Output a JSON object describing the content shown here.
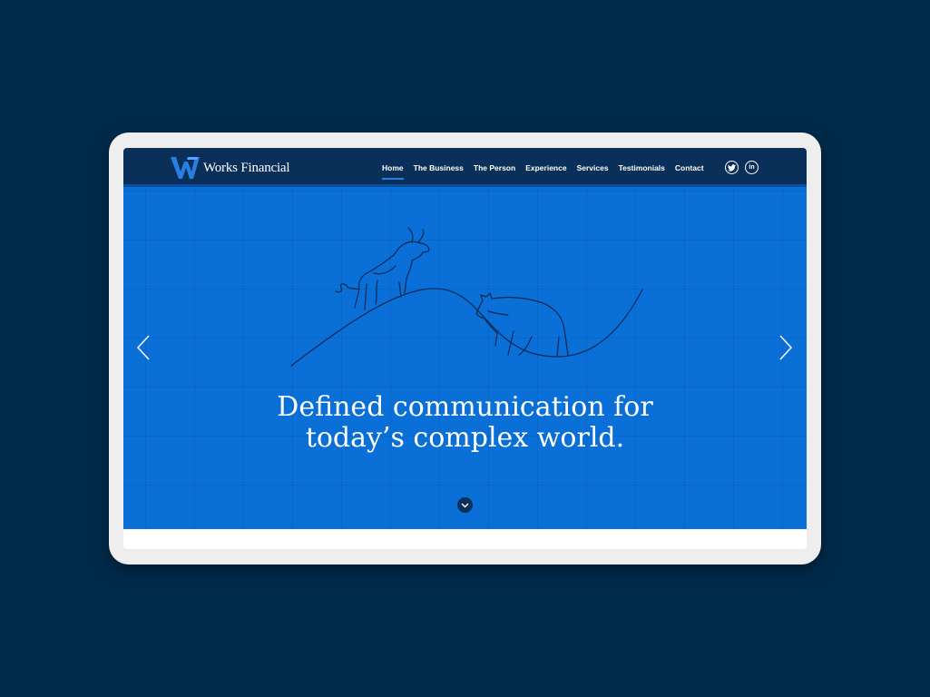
{
  "brand": {
    "name": "Works Financial",
    "accent": "#2a7de1",
    "navy": "#0a2f58",
    "hero_blue": "#0a6fd6"
  },
  "nav": {
    "items": [
      {
        "label": "Home",
        "active": true
      },
      {
        "label": "The Business"
      },
      {
        "label": "The Person"
      },
      {
        "label": "Experience"
      },
      {
        "label": "Services"
      },
      {
        "label": "Testimonials"
      },
      {
        "label": "Contact"
      }
    ]
  },
  "socials": [
    {
      "icon": "twitter-icon"
    },
    {
      "icon": "linkedin-icon",
      "glyph": "in"
    }
  ],
  "hero": {
    "headline_line1": "Defined communication for",
    "headline_line2": "today’s complex world."
  }
}
